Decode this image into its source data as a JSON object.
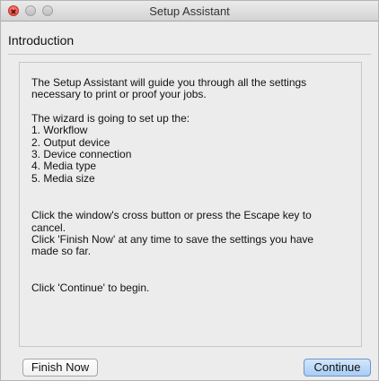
{
  "window": {
    "title": "Setup Assistant"
  },
  "page": {
    "heading": "Introduction"
  },
  "content": {
    "intro_line1": "The Setup Assistant will guide you through all the settings",
    "intro_line2": "necessary to print or proof your jobs.",
    "wizard_line": "The wizard is going to set up the:",
    "steps": [
      "1. Workflow",
      "2. Output device",
      "3. Device connection",
      "4. Media type",
      "5. Media size"
    ],
    "cancel_line1": "Click the window's cross button or press the Escape key to",
    "cancel_line2": "cancel.",
    "finish_line1": "Click 'Finish Now' at any time to save the settings you have",
    "finish_line2": "made so far.",
    "continue_line": "Click 'Continue' to begin."
  },
  "buttons": {
    "finish_now": "Finish Now",
    "continue": "Continue"
  },
  "colors": {
    "window_bg": "#ececec",
    "close_button": "#e0443e",
    "default_button": "#a8cdf5"
  }
}
